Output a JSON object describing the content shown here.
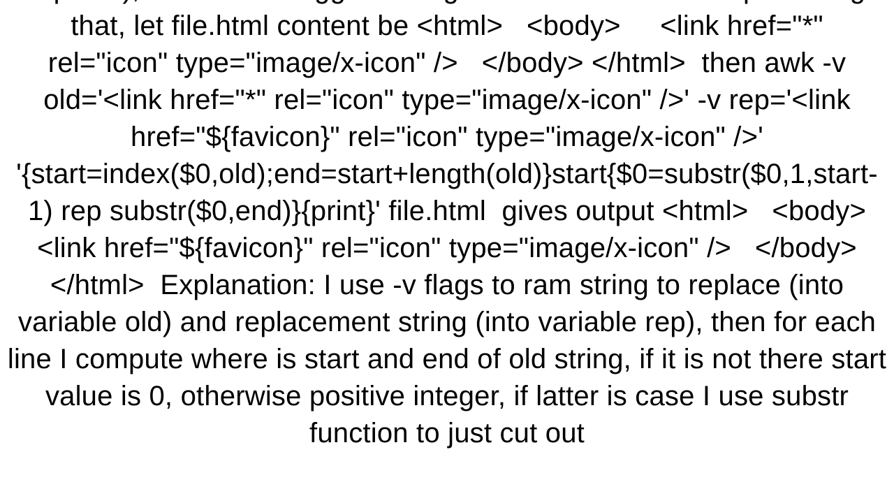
{
  "document": {
    "body_text": "repeats), therefore I suggest using index function for compensating that, let file.html content be <html>   <body>     <link href=\"*\" rel=\"icon\" type=\"image/x-icon\" />   </body> </html>  then awk -v old='<link href=\"*\" rel=\"icon\" type=\"image/x-icon\" />' -v rep='<link href=\"${favicon}\" rel=\"icon\" type=\"image/x-icon\" />' '{start=index($0,old);end=start+length(old)}start{$0=substr($0,1,start-1) rep substr($0,end)}{print}' file.html  gives output <html>   <body>     <link href=\"${favicon}\" rel=\"icon\" type=\"image/x-icon\" />   </body> </html>  Explanation: I use -v flags to ram string to replace (into variable old) and replacement string (into variable rep), then for each line I compute where is start and end of old string, if it is not there start value is 0, otherwise positive integer, if latter is case I use substr function to just cut out"
  }
}
